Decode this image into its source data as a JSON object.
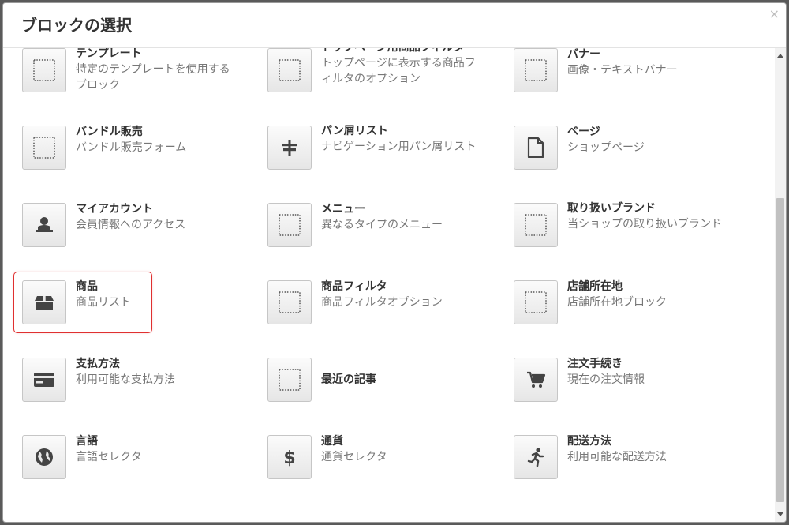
{
  "dialog": {
    "title": "ブロックの選択",
    "close_symbol": "×"
  },
  "blocks": [
    {
      "key": "template",
      "name": "テンプレート",
      "desc": "特定のテンプレートを使用するブロック",
      "icon": "placeholder-icon",
      "col": 0,
      "row": 0
    },
    {
      "key": "toppage-filter",
      "name": "トップページ用商品フィルタ",
      "desc": "トップページに表示する商品フィルタのオプション",
      "icon": "placeholder-icon",
      "col": 1,
      "row": 0
    },
    {
      "key": "banner",
      "name": "バナー",
      "desc": "画像・テキストバナー",
      "icon": "placeholder-icon",
      "col": 2,
      "row": 0
    },
    {
      "key": "bundle",
      "name": "バンドル販売",
      "desc": "バンドル販売フォーム",
      "icon": "placeholder-icon",
      "col": 0,
      "row": 1
    },
    {
      "key": "breadcrumb",
      "name": "パン屑リスト",
      "desc": "ナビゲーション用パン屑リスト",
      "icon": "signpost-icon",
      "col": 1,
      "row": 1
    },
    {
      "key": "page",
      "name": "ページ",
      "desc": "ショップページ",
      "icon": "document-icon",
      "col": 2,
      "row": 1
    },
    {
      "key": "myaccount",
      "name": "マイアカウント",
      "desc": "会員情報へのアクセス",
      "icon": "user-icon",
      "col": 0,
      "row": 2
    },
    {
      "key": "menu",
      "name": "メニュー",
      "desc": "異なるタイプのメニュー",
      "icon": "placeholder-icon",
      "col": 1,
      "row": 2
    },
    {
      "key": "brands",
      "name": "取り扱いブランド",
      "desc": "当ショップの取り扱いブランド",
      "icon": "placeholder-icon",
      "col": 2,
      "row": 2
    },
    {
      "key": "products",
      "name": "商品",
      "desc": "商品リスト",
      "icon": "box-icon",
      "col": 0,
      "row": 3,
      "selected": true
    },
    {
      "key": "product-filter",
      "name": "商品フィルタ",
      "desc": "商品フィルタオプション",
      "icon": "placeholder-icon",
      "col": 1,
      "row": 3
    },
    {
      "key": "store-location",
      "name": "店舗所在地",
      "desc": "店舗所在地ブロック",
      "icon": "placeholder-icon",
      "col": 2,
      "row": 3
    },
    {
      "key": "payment",
      "name": "支払方法",
      "desc": "利用可能な支払方法",
      "icon": "credit-card-icon",
      "col": 0,
      "row": 4
    },
    {
      "key": "recent-posts",
      "name": "最近の記事",
      "desc": "",
      "icon": "placeholder-icon",
      "col": 1,
      "row": 4
    },
    {
      "key": "checkout",
      "name": "注文手続き",
      "desc": "現在の注文情報",
      "icon": "cart-icon",
      "col": 2,
      "row": 4
    },
    {
      "key": "language",
      "name": "言語",
      "desc": "言語セレクタ",
      "icon": "globe-icon",
      "col": 0,
      "row": 5
    },
    {
      "key": "currency",
      "name": "通貨",
      "desc": "通貨セレクタ",
      "icon": "dollar-icon",
      "col": 1,
      "row": 5
    },
    {
      "key": "shipping",
      "name": "配送方法",
      "desc": "利用可能な配送方法",
      "icon": "running-icon",
      "col": 2,
      "row": 5
    }
  ],
  "colors": {
    "selected_outline": "#e03030",
    "icon_color": "#444444"
  }
}
